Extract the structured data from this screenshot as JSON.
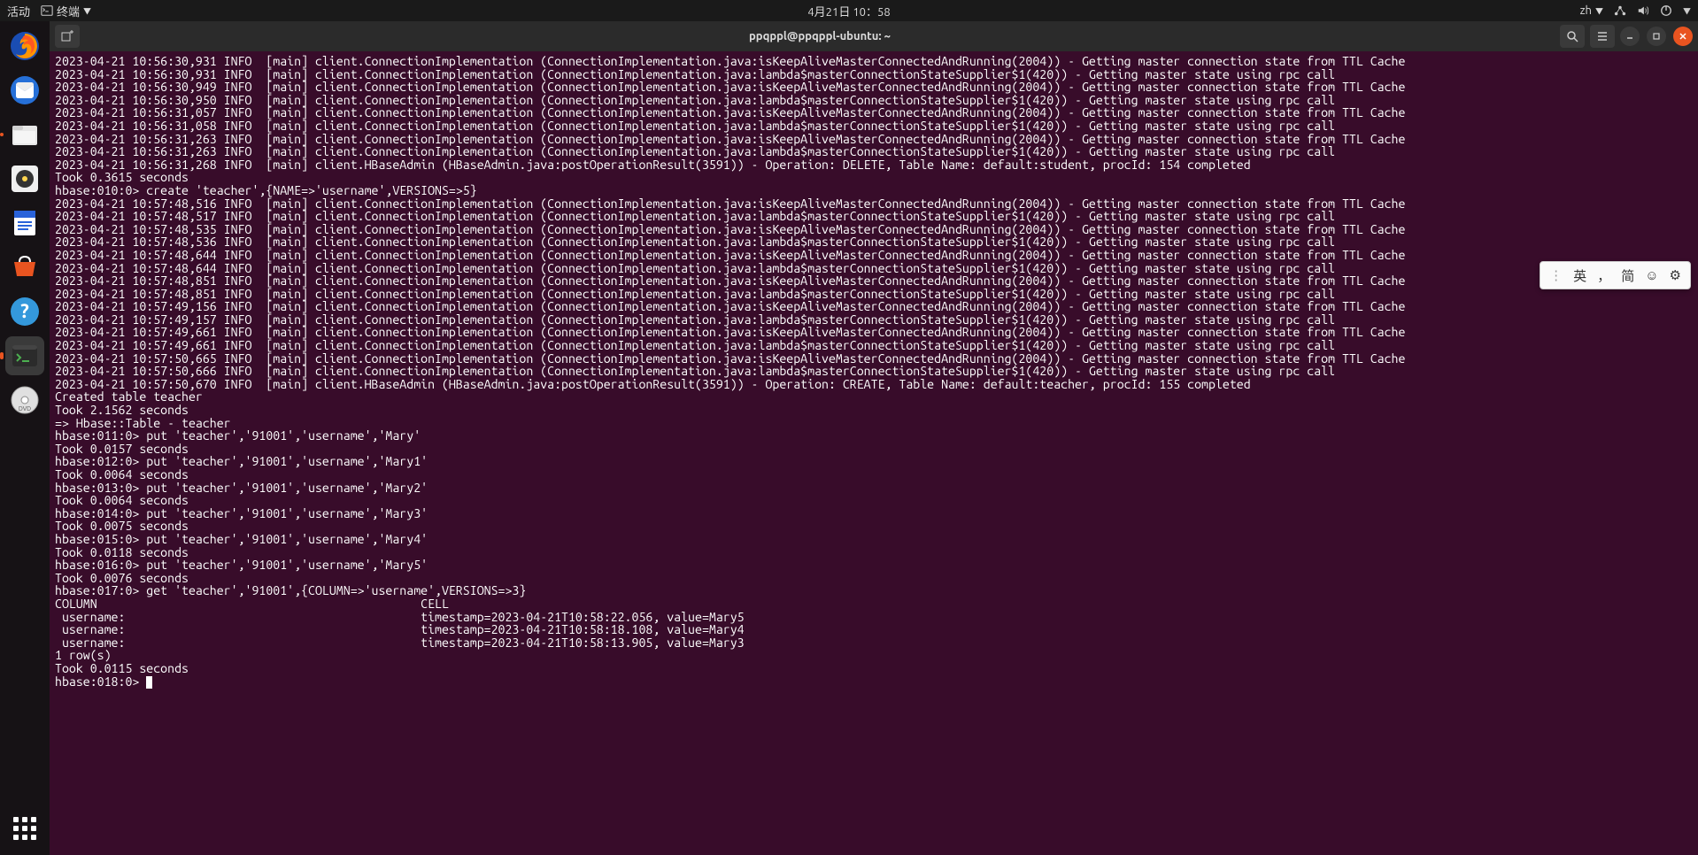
{
  "topbar": {
    "activities": "活动",
    "app_label": "终端",
    "datetime": "4月21日 10：58",
    "lang": "zh"
  },
  "window": {
    "title": "ppqppl@ppqppl-ubuntu: ~"
  },
  "ime": {
    "mode1": "英",
    "punct": "，",
    "mode2": "简",
    "emoji": "☺",
    "gear": "⚙"
  },
  "terminal_lines": [
    "2023-04-21 10:56:30,931 INFO  [main] client.ConnectionImplementation (ConnectionImplementation.java:isKeepAliveMasterConnectedAndRunning(2004)) - Getting master connection state from TTL Cache",
    "2023-04-21 10:56:30,931 INFO  [main] client.ConnectionImplementation (ConnectionImplementation.java:lambda$masterConnectionStateSupplier$1(420)) - Getting master state using rpc call",
    "2023-04-21 10:56:30,949 INFO  [main] client.ConnectionImplementation (ConnectionImplementation.java:isKeepAliveMasterConnectedAndRunning(2004)) - Getting master connection state from TTL Cache",
    "2023-04-21 10:56:30,950 INFO  [main] client.ConnectionImplementation (ConnectionImplementation.java:lambda$masterConnectionStateSupplier$1(420)) - Getting master state using rpc call",
    "2023-04-21 10:56:31,057 INFO  [main] client.ConnectionImplementation (ConnectionImplementation.java:isKeepAliveMasterConnectedAndRunning(2004)) - Getting master connection state from TTL Cache",
    "2023-04-21 10:56:31,058 INFO  [main] client.ConnectionImplementation (ConnectionImplementation.java:lambda$masterConnectionStateSupplier$1(420)) - Getting master state using rpc call",
    "2023-04-21 10:56:31,263 INFO  [main] client.ConnectionImplementation (ConnectionImplementation.java:isKeepAliveMasterConnectedAndRunning(2004)) - Getting master connection state from TTL Cache",
    "2023-04-21 10:56:31,263 INFO  [main] client.ConnectionImplementation (ConnectionImplementation.java:lambda$masterConnectionStateSupplier$1(420)) - Getting master state using rpc call",
    "2023-04-21 10:56:31,268 INFO  [main] client.HBaseAdmin (HBaseAdmin.java:postOperationResult(3591)) - Operation: DELETE, Table Name: default:student, procId: 154 completed",
    "Took 0.3615 seconds",
    "hbase:010:0> create 'teacher',{NAME=>'username',VERSIONS=>5}",
    "2023-04-21 10:57:48,516 INFO  [main] client.ConnectionImplementation (ConnectionImplementation.java:isKeepAliveMasterConnectedAndRunning(2004)) - Getting master connection state from TTL Cache",
    "2023-04-21 10:57:48,517 INFO  [main] client.ConnectionImplementation (ConnectionImplementation.java:lambda$masterConnectionStateSupplier$1(420)) - Getting master state using rpc call",
    "2023-04-21 10:57:48,535 INFO  [main] client.ConnectionImplementation (ConnectionImplementation.java:isKeepAliveMasterConnectedAndRunning(2004)) - Getting master connection state from TTL Cache",
    "2023-04-21 10:57:48,536 INFO  [main] client.ConnectionImplementation (ConnectionImplementation.java:lambda$masterConnectionStateSupplier$1(420)) - Getting master state using rpc call",
    "2023-04-21 10:57:48,644 INFO  [main] client.ConnectionImplementation (ConnectionImplementation.java:isKeepAliveMasterConnectedAndRunning(2004)) - Getting master connection state from TTL Cache",
    "2023-04-21 10:57:48,644 INFO  [main] client.ConnectionImplementation (ConnectionImplementation.java:lambda$masterConnectionStateSupplier$1(420)) - Getting master state using rpc call",
    "2023-04-21 10:57:48,851 INFO  [main] client.ConnectionImplementation (ConnectionImplementation.java:isKeepAliveMasterConnectedAndRunning(2004)) - Getting master connection state from TTL Cache",
    "2023-04-21 10:57:48,851 INFO  [main] client.ConnectionImplementation (ConnectionImplementation.java:lambda$masterConnectionStateSupplier$1(420)) - Getting master state using rpc call",
    "2023-04-21 10:57:49,156 INFO  [main] client.ConnectionImplementation (ConnectionImplementation.java:isKeepAliveMasterConnectedAndRunning(2004)) - Getting master connection state from TTL Cache",
    "2023-04-21 10:57:49,157 INFO  [main] client.ConnectionImplementation (ConnectionImplementation.java:lambda$masterConnectionStateSupplier$1(420)) - Getting master state using rpc call",
    "2023-04-21 10:57:49,661 INFO  [main] client.ConnectionImplementation (ConnectionImplementation.java:isKeepAliveMasterConnectedAndRunning(2004)) - Getting master connection state from TTL Cache",
    "2023-04-21 10:57:49,661 INFO  [main] client.ConnectionImplementation (ConnectionImplementation.java:lambda$masterConnectionStateSupplier$1(420)) - Getting master state using rpc call",
    "2023-04-21 10:57:50,665 INFO  [main] client.ConnectionImplementation (ConnectionImplementation.java:isKeepAliveMasterConnectedAndRunning(2004)) - Getting master connection state from TTL Cache",
    "2023-04-21 10:57:50,666 INFO  [main] client.ConnectionImplementation (ConnectionImplementation.java:lambda$masterConnectionStateSupplier$1(420)) - Getting master state using rpc call",
    "2023-04-21 10:57:50,670 INFO  [main] client.HBaseAdmin (HBaseAdmin.java:postOperationResult(3591)) - Operation: CREATE, Table Name: default:teacher, procId: 155 completed",
    "Created table teacher",
    "Took 2.1562 seconds",
    "=> Hbase::Table - teacher",
    "hbase:011:0> put 'teacher','91001','username','Mary'",
    "Took 0.0157 seconds",
    "hbase:012:0> put 'teacher','91001','username','Mary1'",
    "Took 0.0064 seconds",
    "hbase:013:0> put 'teacher','91001','username','Mary2'",
    "Took 0.0064 seconds",
    "hbase:014:0> put 'teacher','91001','username','Mary3'",
    "Took 0.0075 seconds",
    "hbase:015:0> put 'teacher','91001','username','Mary4'",
    "Took 0.0118 seconds",
    "hbase:016:0> put 'teacher','91001','username','Mary5'",
    "Took 0.0076 seconds",
    "hbase:017:0> get 'teacher','91001',{COLUMN=>'username',VERSIONS=>3}",
    "COLUMN                                              CELL",
    " username:                                          timestamp=2023-04-21T10:58:22.056, value=Mary5",
    " username:                                          timestamp=2023-04-21T10:58:18.108, value=Mary4",
    " username:                                          timestamp=2023-04-21T10:58:13.905, value=Mary3",
    "1 row(s)",
    "Took 0.0115 seconds",
    "hbase:018:0> "
  ]
}
